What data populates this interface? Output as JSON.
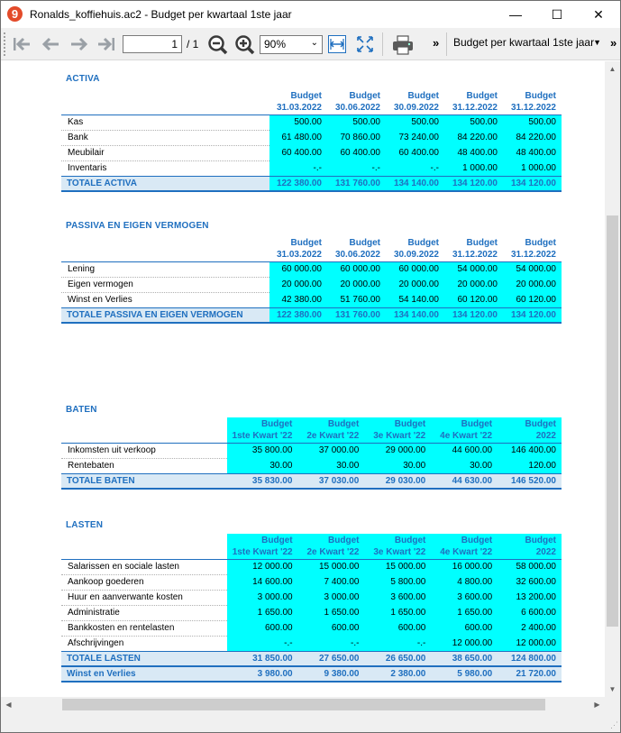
{
  "window": {
    "title": "Ronalds_koffiehuis.ac2 - Budget per kwartaal 1ste jaar",
    "app_icon_glyph": "9",
    "minimize_glyph": "—",
    "maximize_glyph": "☐",
    "close_glyph": "✕"
  },
  "toolbar": {
    "page_value": "1",
    "page_total": "/ 1",
    "zoom_value": "90%",
    "more_glyph": "»",
    "report_name": "Budget per kwartaal 1ste jaar",
    "icons": [
      "first-page-icon",
      "prev-page-icon",
      "next-page-icon",
      "last-page-icon",
      "zoom-out-icon",
      "zoom-in-icon",
      "fit-width-icon",
      "fit-page-icon",
      "print-icon"
    ]
  },
  "colors": {
    "accent": "#1f6fbf",
    "cyan": "#00ffff",
    "total_bg": "#d9e9f5"
  },
  "activa": {
    "title": "ACTIVA",
    "headers": [
      {
        "l1": "Budget",
        "l2": "31.03.2022"
      },
      {
        "l1": "Budget",
        "l2": "30.06.2022"
      },
      {
        "l1": "Budget",
        "l2": "30.09.2022"
      },
      {
        "l1": "Budget",
        "l2": "31.12.2022"
      },
      {
        "l1": "Budget",
        "l2": "31.12.2022"
      }
    ],
    "rows": [
      {
        "label": "Kas",
        "values": [
          "500.00",
          "500.00",
          "500.00",
          "500.00",
          "500.00"
        ]
      },
      {
        "label": "Bank",
        "values": [
          "61 480.00",
          "70 860.00",
          "73 240.00",
          "84 220.00",
          "84 220.00"
        ]
      },
      {
        "label": "Meubilair",
        "values": [
          "60 400.00",
          "60 400.00",
          "60 400.00",
          "48 400.00",
          "48 400.00"
        ]
      },
      {
        "label": "Inventaris",
        "values": [
          "-.-",
          "-.-",
          "-.-",
          "1 000.00",
          "1 000.00"
        ]
      }
    ],
    "total": {
      "label": "TOTALE ACTIVA",
      "values": [
        "122 380.00",
        "131 760.00",
        "134 140.00",
        "134 120.00",
        "134 120.00"
      ]
    }
  },
  "passiva": {
    "title": "PASSIVA EN EIGEN VERMOGEN",
    "headers": [
      {
        "l1": "Budget",
        "l2": "31.03.2022"
      },
      {
        "l1": "Budget",
        "l2": "30.06.2022"
      },
      {
        "l1": "Budget",
        "l2": "30.09.2022"
      },
      {
        "l1": "Budget",
        "l2": "31.12.2022"
      },
      {
        "l1": "Budget",
        "l2": "31.12.2022"
      }
    ],
    "rows": [
      {
        "label": "Lening",
        "values": [
          "60 000.00",
          "60 000.00",
          "60 000.00",
          "54 000.00",
          "54 000.00"
        ]
      },
      {
        "label": "Eigen vermogen",
        "values": [
          "20 000.00",
          "20 000.00",
          "20 000.00",
          "20 000.00",
          "20 000.00"
        ]
      },
      {
        "label": "Winst en Verlies",
        "values": [
          "42 380.00",
          "51 760.00",
          "54 140.00",
          "60 120.00",
          "60 120.00"
        ]
      }
    ],
    "total": {
      "label": "TOTALE PASSIVA EN EIGEN VERMOGEN",
      "values": [
        "122 380.00",
        "131 760.00",
        "134 140.00",
        "134 120.00",
        "134 120.00"
      ]
    }
  },
  "baten": {
    "title": "BATEN",
    "headers": [
      {
        "l1": "Budget",
        "l2": "1ste Kwart '22"
      },
      {
        "l1": "Budget",
        "l2": "2e Kwart '22"
      },
      {
        "l1": "Budget",
        "l2": "3e Kwart '22"
      },
      {
        "l1": "Budget",
        "l2": "4e Kwart '22"
      },
      {
        "l1": "Budget",
        "l2": "2022"
      }
    ],
    "rows": [
      {
        "label": "Inkomsten uit verkoop",
        "values": [
          "35 800.00",
          "37 000.00",
          "29 000.00",
          "44 600.00",
          "146 400.00"
        ]
      },
      {
        "label": "Rentebaten",
        "values": [
          "30.00",
          "30.00",
          "30.00",
          "30.00",
          "120.00"
        ]
      }
    ],
    "total": {
      "label": "TOTALE BATEN",
      "values": [
        "35 830.00",
        "37 030.00",
        "29 030.00",
        "44 630.00",
        "146 520.00"
      ]
    }
  },
  "lasten": {
    "title": "LASTEN",
    "headers": [
      {
        "l1": "Budget",
        "l2": "1ste Kwart '22"
      },
      {
        "l1": "Budget",
        "l2": "2e Kwart '22"
      },
      {
        "l1": "Budget",
        "l2": "3e Kwart '22"
      },
      {
        "l1": "Budget",
        "l2": "4e Kwart '22"
      },
      {
        "l1": "Budget",
        "l2": "2022"
      }
    ],
    "rows": [
      {
        "label": "Salarissen en sociale lasten",
        "values": [
          "12 000.00",
          "15 000.00",
          "15 000.00",
          "16 000.00",
          "58 000.00"
        ]
      },
      {
        "label": "Aankoop goederen",
        "values": [
          "14 600.00",
          "7 400.00",
          "5 800.00",
          "4 800.00",
          "32 600.00"
        ]
      },
      {
        "label": "Huur en aanverwante kosten",
        "values": [
          "3 000.00",
          "3 000.00",
          "3 600.00",
          "3 600.00",
          "13 200.00"
        ]
      },
      {
        "label": "Administratie",
        "values": [
          "1 650.00",
          "1 650.00",
          "1 650.00",
          "1 650.00",
          "6 600.00"
        ]
      },
      {
        "label": "Bankkosten en rentelasten",
        "values": [
          "600.00",
          "600.00",
          "600.00",
          "600.00",
          "2 400.00"
        ]
      },
      {
        "label": "Afschrijvingen",
        "values": [
          "-.-",
          "-.-",
          "-.-",
          "12 000.00",
          "12 000.00"
        ]
      }
    ],
    "total": {
      "label": "TOTALE LASTEN",
      "values": [
        "31 850.00",
        "27 650.00",
        "26 650.00",
        "38 650.00",
        "124 800.00"
      ]
    },
    "net": {
      "label": "Winst en Verlies",
      "values": [
        "3 980.00",
        "9 380.00",
        "2 380.00",
        "5 980.00",
        "21 720.00"
      ]
    }
  }
}
